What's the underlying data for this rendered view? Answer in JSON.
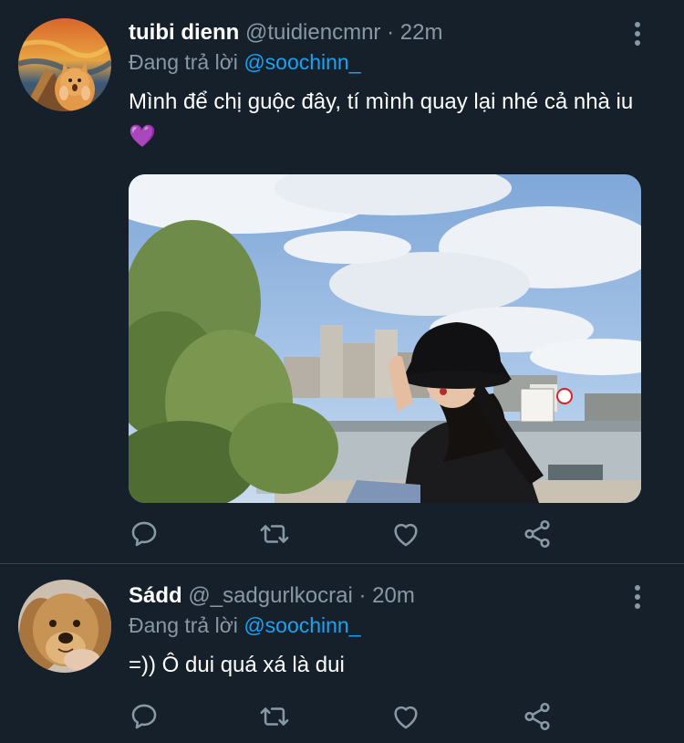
{
  "tweets": [
    {
      "name": "tuibi dienn",
      "handle": "@tuidiencmnr",
      "separator": "·",
      "time": "22m",
      "reply_prefix": "Đang trả lời",
      "reply_to": "@soochinn_",
      "text": "Mình để chị guộc đây, tí mình quay lại nhé cả nhà iu 💜",
      "has_media": true,
      "avatar_icon": "scream-cat-avatar"
    },
    {
      "name": "Sádd",
      "handle": "@_sadgurlkocrai",
      "separator": "·",
      "time": "20m",
      "reply_prefix": "Đang trả lời",
      "reply_to": "@soochinn_",
      "text": "=)) Ô dui quá xá là dui",
      "has_media": false,
      "avatar_icon": "dog-avatar"
    }
  ],
  "actions": [
    "reply-icon",
    "retweet-icon",
    "like-icon",
    "share-icon"
  ],
  "colors": {
    "background": "#15202b",
    "secondary_text": "#8899a6",
    "link": "#1da1f2",
    "divider": "#38444d"
  }
}
